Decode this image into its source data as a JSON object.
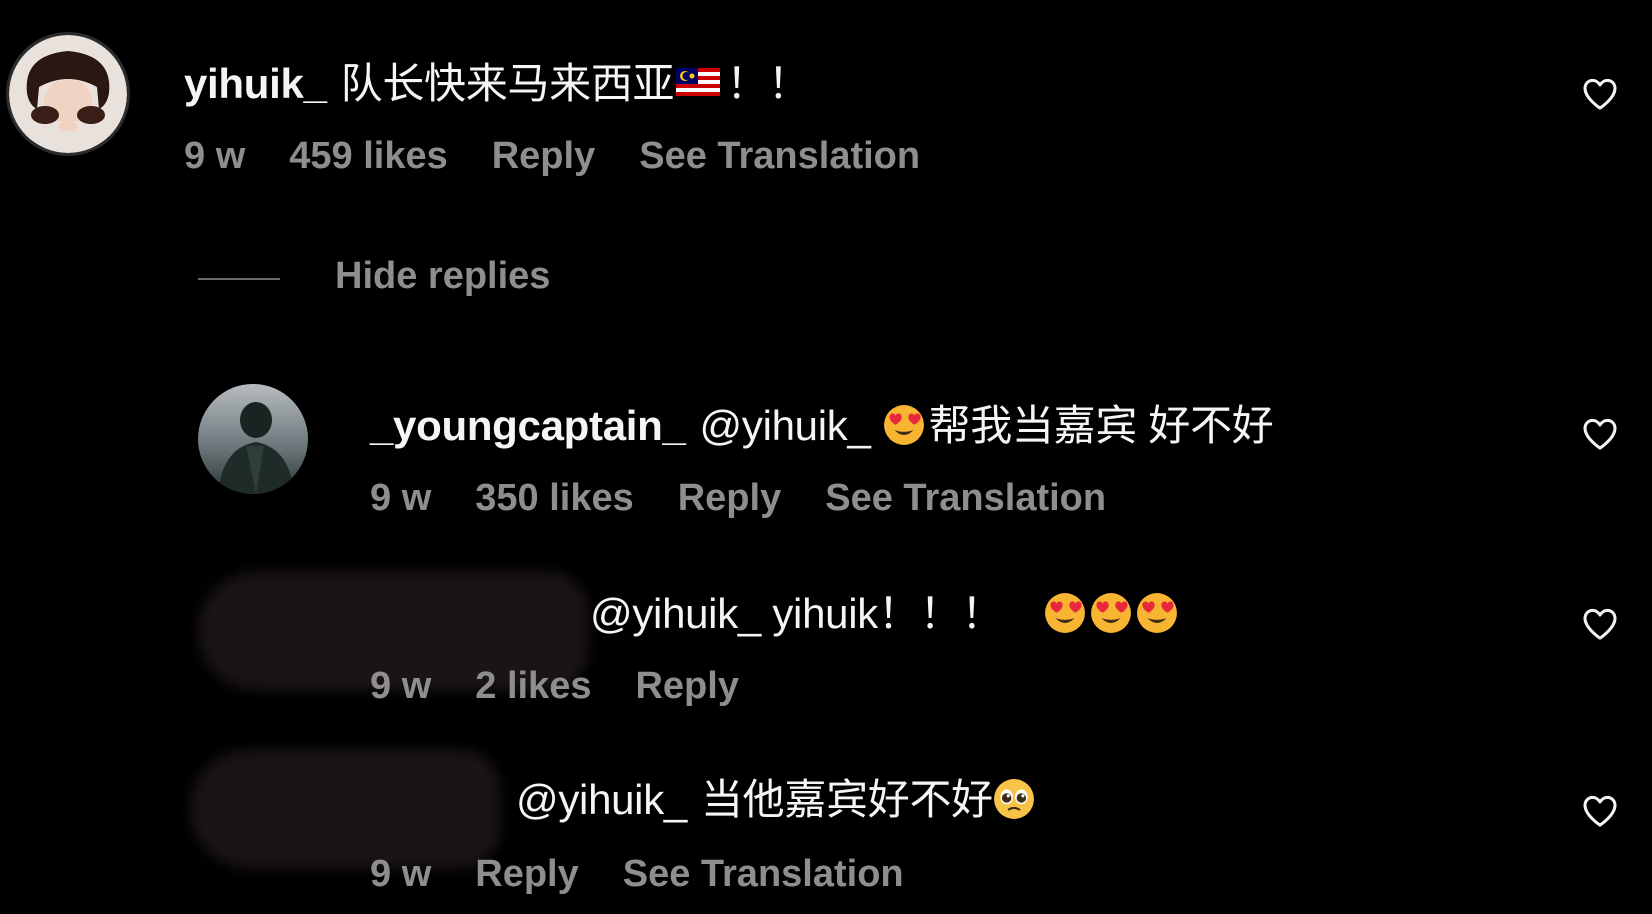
{
  "comment": {
    "username": "yihuik_",
    "text": "队长快来马来西亚",
    "exclaim": "！！",
    "meta": {
      "time": "9 w",
      "likes": "459 likes",
      "reply": "Reply",
      "translate": "See Translation"
    }
  },
  "hide_replies_label": "Hide replies",
  "replies": [
    {
      "username": "_youngcaptain_",
      "mention": "@yihuik_",
      "text": "帮我当嘉宾 好不好",
      "meta": {
        "time": "9 w",
        "likes": "350 likes",
        "reply": "Reply",
        "translate": "See Translation"
      }
    },
    {
      "mention": "@yihuik_",
      "text": "yihuik！！！",
      "meta": {
        "time": "9 w",
        "likes": "2 likes",
        "reply": "Reply"
      }
    },
    {
      "mention": "@yihuik_",
      "text": "当他嘉宾好不好",
      "meta": {
        "time": "9 w",
        "reply": "Reply",
        "translate": "See Translation"
      }
    }
  ],
  "icons": {
    "heart": "heart-outline-icon",
    "flag": "malaysia-flag-emoji",
    "heart_eyes": "heart-eyes-emoji",
    "pleading": "pleading-face-emoji"
  },
  "colors": {
    "background": "#000000",
    "text": "#f5f5f5",
    "meta": "#8e8e8e"
  }
}
